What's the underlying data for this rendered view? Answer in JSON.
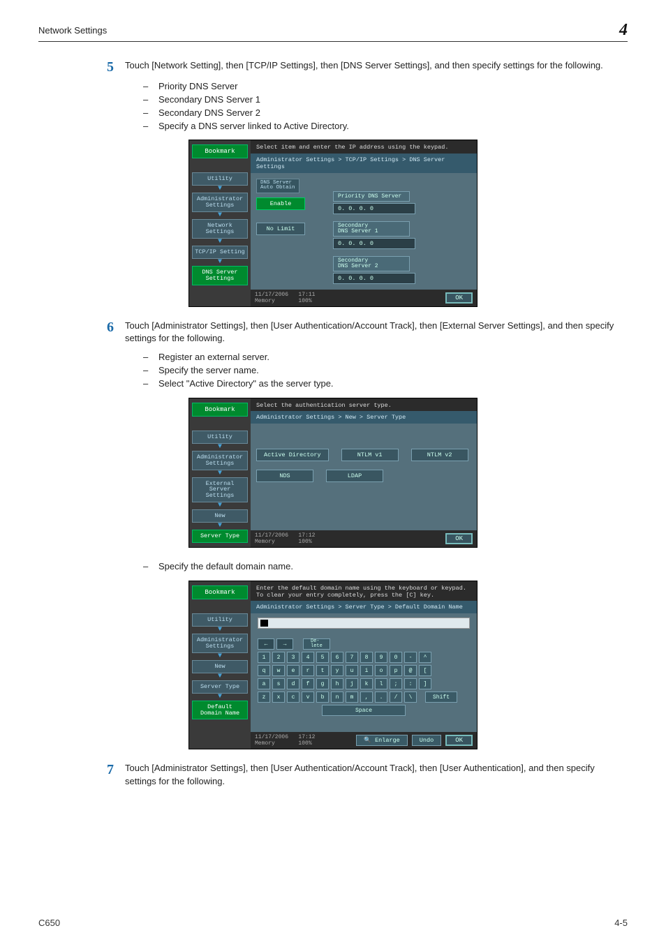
{
  "header": {
    "section": "Network Settings",
    "chapter": "4"
  },
  "steps": {
    "s5": {
      "num": "5",
      "text": "Touch [Network Setting], then [TCP/IP Settings], then [DNS Server Settings], and then specify settings for the following.",
      "bullets": [
        "Priority DNS Server",
        "Secondary DNS Server 1",
        "Secondary DNS Server 2",
        "Specify a DNS server linked to Active Directory."
      ]
    },
    "s6": {
      "num": "6",
      "text": "Touch [Administrator Settings], then [User Authentication/Account Track], then [External Server Settings], and then specify settings for the following.",
      "bullets": [
        "Register an external server.",
        "Specify the server name.",
        "Select \"Active Directory\" as the server type."
      ],
      "bullet_after": "Specify the default domain name."
    },
    "s7": {
      "num": "7",
      "text": "Touch [Administrator Settings], then [User Authentication/Account Track], then [User Authentication], and then specify settings for the following."
    }
  },
  "screen1": {
    "top": "Select item and enter the IP address using the keypad.",
    "bc": "Administrator Settings > TCP/IP Settings > DNS Server Settings",
    "bookmark": "Bookmark",
    "crumbs": [
      "Utility",
      "Administrator\nSettings",
      "Network\nSettings",
      "TCP/IP Setting",
      "DNS Server\nSettings"
    ],
    "tab": "DNS Server\nAuto Obtain",
    "enable": "Enable",
    "nolimit": "No Limit",
    "fields": [
      {
        "label": "Priority DNS Server",
        "val": "0. 0. 0. 0"
      },
      {
        "label": "Secondary\nDNS Server 1",
        "val": "0. 0. 0. 0"
      },
      {
        "label": "Secondary\nDNS Server 2",
        "val": "0. 0. 0. 0"
      }
    ],
    "date": "11/17/2006",
    "time": "17:11",
    "mem": "Memory",
    "pct": "100%",
    "ok": "OK"
  },
  "screen2": {
    "top": "Select the authentication server type.",
    "bc": "Administrator Settings > New > Server Type",
    "bookmark": "Bookmark",
    "crumbs": [
      "Utility",
      "Administrator\nSettings",
      "External Server\nSettings",
      "New",
      "Server Type"
    ],
    "opts": [
      "Active Directory",
      "NTLM v1",
      "NTLM v2",
      "NDS",
      "LDAP"
    ],
    "date": "11/17/2006",
    "time": "17:12",
    "mem": "Memory",
    "pct": "100%",
    "ok": "OK"
  },
  "screen3": {
    "top1": "Enter the default domain name using the keyboard or keypad.",
    "top2": "To clear your entry completely, press the [C] key.",
    "bc": "Administrator Settings > Server Type > Default Domain Name",
    "bookmark": "Bookmark",
    "crumbs": [
      "Utility",
      "Administrator\nSettings",
      "New",
      "Server Type",
      "Default\nDomain Name"
    ],
    "delete": "De-\nlete",
    "row1": [
      "1",
      "2",
      "3",
      "4",
      "5",
      "6",
      "7",
      "8",
      "9",
      "0",
      "-",
      "^"
    ],
    "row2": [
      "q",
      "w",
      "e",
      "r",
      "t",
      "y",
      "u",
      "i",
      "o",
      "p",
      "@",
      "["
    ],
    "row3": [
      "a",
      "s",
      "d",
      "f",
      "g",
      "h",
      "j",
      "k",
      "l",
      ";",
      ":",
      "]"
    ],
    "row4": [
      "z",
      "x",
      "c",
      "v",
      "b",
      "n",
      "m",
      ",",
      ".",
      "/",
      "\\"
    ],
    "shift": "Shift",
    "space": "Space",
    "enlarge": "Enlarge",
    "undo": "Undo",
    "ok": "OK",
    "date": "11/17/2006",
    "time": "17:12",
    "mem": "Memory",
    "pct": "100%"
  },
  "footer": {
    "left": "C650",
    "right": "4-5"
  }
}
